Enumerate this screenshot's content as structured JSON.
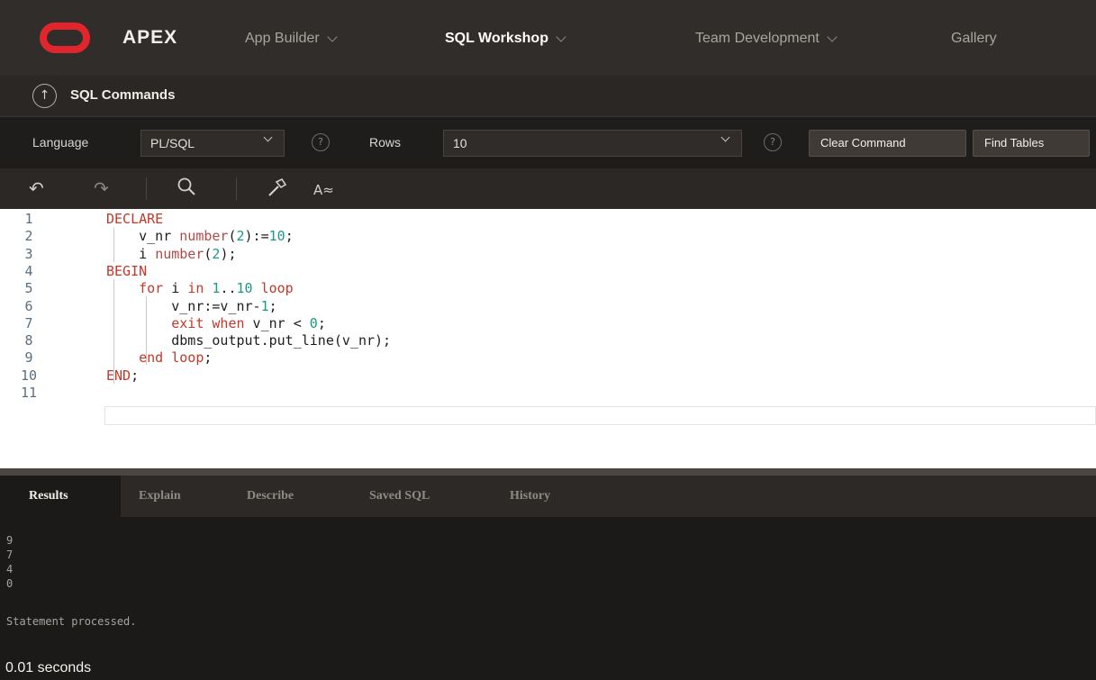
{
  "topnav": {
    "brand": "APEX",
    "items": [
      {
        "label": "App Builder",
        "active": false
      },
      {
        "label": "SQL Workshop",
        "active": true
      },
      {
        "label": "Team Development",
        "active": false
      },
      {
        "label": "Gallery",
        "active": false
      }
    ]
  },
  "breadcrumb": {
    "title": "SQL Commands",
    "up_icon": "arrow-up-circle-icon"
  },
  "options": {
    "language_label": "Language",
    "language_value": "PL/SQL",
    "help_glyph": "?",
    "rows_label": "Rows",
    "rows_value": "10",
    "clear_command": "Clear Command",
    "find_tables": "Find Tables"
  },
  "editor_toolbar": {
    "undo_icon": "undo-icon",
    "redo_icon": "redo-icon",
    "search_icon": "search-icon",
    "hammer_icon": "hammer-icon",
    "autocomplete_label": "A≈"
  },
  "editor": {
    "lines": [
      {
        "n": "1",
        "segments": [
          {
            "t": "DECLARE",
            "c": "kw"
          }
        ]
      },
      {
        "n": "2",
        "segments": [
          {
            "t": "    v_nr ",
            "c": ""
          },
          {
            "t": "number",
            "c": "ty"
          },
          {
            "t": "(",
            "c": ""
          },
          {
            "t": "2",
            "c": "num"
          },
          {
            "t": "):=",
            "c": ""
          },
          {
            "t": "10",
            "c": "num"
          },
          {
            "t": ";",
            "c": ""
          }
        ]
      },
      {
        "n": "3",
        "segments": [
          {
            "t": "    i ",
            "c": ""
          },
          {
            "t": "number",
            "c": "ty"
          },
          {
            "t": "(",
            "c": ""
          },
          {
            "t": "2",
            "c": "num"
          },
          {
            "t": ");",
            "c": ""
          }
        ]
      },
      {
        "n": "4",
        "segments": [
          {
            "t": "BEGIN",
            "c": "kw"
          }
        ]
      },
      {
        "n": "5",
        "segments": [
          {
            "t": "    ",
            "c": ""
          },
          {
            "t": "for",
            "c": "kw"
          },
          {
            "t": " i ",
            "c": ""
          },
          {
            "t": "in",
            "c": "kw"
          },
          {
            "t": " ",
            "c": ""
          },
          {
            "t": "1",
            "c": "num"
          },
          {
            "t": "..",
            "c": ""
          },
          {
            "t": "10",
            "c": "num"
          },
          {
            "t": " ",
            "c": ""
          },
          {
            "t": "loop",
            "c": "kw"
          }
        ]
      },
      {
        "n": "6",
        "segments": [
          {
            "t": "        v_nr:=v_nr-",
            "c": ""
          },
          {
            "t": "1",
            "c": "num"
          },
          {
            "t": ";",
            "c": ""
          }
        ]
      },
      {
        "n": "7",
        "segments": [
          {
            "t": "        ",
            "c": ""
          },
          {
            "t": "exit",
            "c": "kw"
          },
          {
            "t": " ",
            "c": ""
          },
          {
            "t": "when",
            "c": "kw"
          },
          {
            "t": " v_nr < ",
            "c": ""
          },
          {
            "t": "0",
            "c": "num"
          },
          {
            "t": ";",
            "c": ""
          }
        ]
      },
      {
        "n": "8",
        "segments": [
          {
            "t": "        dbms_output.put_line(v_nr);",
            "c": ""
          }
        ]
      },
      {
        "n": "9",
        "segments": [
          {
            "t": "    ",
            "c": ""
          },
          {
            "t": "end",
            "c": "kw"
          },
          {
            "t": " ",
            "c": ""
          },
          {
            "t": "loop",
            "c": "kw"
          },
          {
            "t": ";",
            "c": ""
          }
        ]
      },
      {
        "n": "10",
        "segments": [
          {
            "t": "END",
            "c": "kw"
          },
          {
            "t": ";",
            "c": ""
          }
        ]
      },
      {
        "n": "11",
        "segments": []
      }
    ]
  },
  "results": {
    "tabs": [
      {
        "label": "Results",
        "active": true
      },
      {
        "label": "Explain",
        "active": false
      },
      {
        "label": "Describe",
        "active": false
      },
      {
        "label": "Saved SQL",
        "active": false
      },
      {
        "label": "History",
        "active": false
      }
    ],
    "output_lines": [
      "9",
      "7",
      "4",
      "0"
    ],
    "status": "Statement processed.",
    "elapsed": "0.01 seconds"
  }
}
